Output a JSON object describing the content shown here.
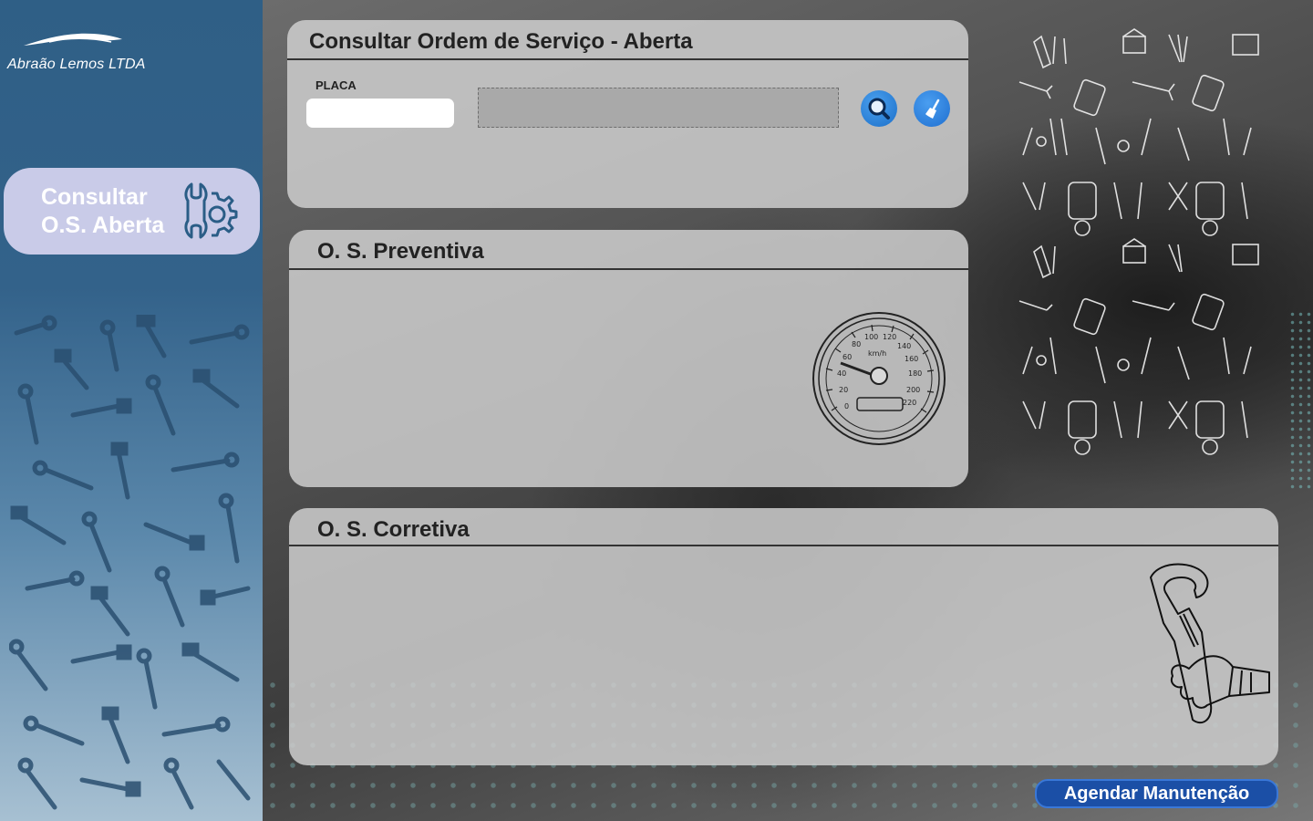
{
  "brand": {
    "name": "Abraão Lemos LTDA",
    "logo_icon": "car-silhouette-icon"
  },
  "sidebar": {
    "nav_item": {
      "label": "Consultar\nO.S. Aberta",
      "icon": "wrench-gear-icon"
    },
    "pattern_icon": "tools-pattern"
  },
  "consult_panel": {
    "title": "Consultar Ordem de Serviço - Aberta",
    "placa_label": "PLACA",
    "placa_value": "",
    "result_value": "",
    "search_icon": "search-icon",
    "clear_icon": "broom-icon"
  },
  "preventiva_panel": {
    "title": "O. S. Preventiva",
    "illustration": "speedometer-icon"
  },
  "corretiva_panel": {
    "title": "O. S. Corretiva",
    "illustration": "hand-wrench-icon"
  },
  "actions": {
    "schedule_label": "Agendar Manutenção"
  },
  "colors": {
    "sidebar_top": "#2f5f86",
    "sidebar_bottom": "#a7c0d2",
    "nav_card": "#c9cbe8",
    "panel_bg": "#cdcdcd",
    "primary_button": "#1b4fa6",
    "icon_button": "#1c6fc9"
  }
}
